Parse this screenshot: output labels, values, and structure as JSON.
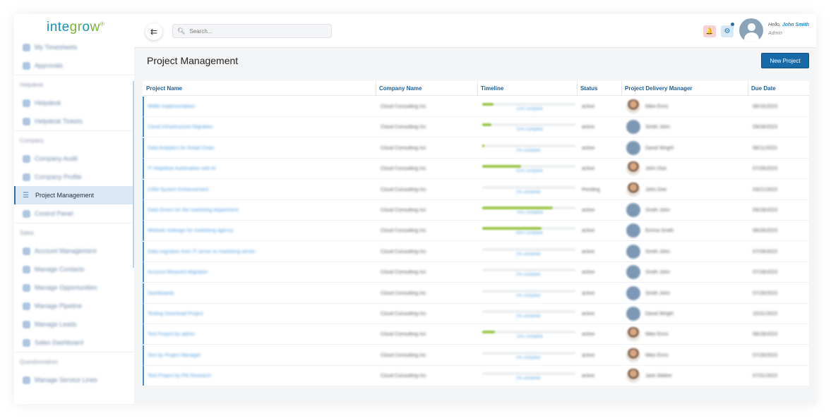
{
  "brand": {
    "logo_a": "inte",
    "logo_b": "gr",
    "logo_c": "o",
    "logo_d": "w",
    "logo_mark": "®"
  },
  "sidebar": {
    "items": [
      {
        "label": "My Timesheets",
        "type": "item"
      },
      {
        "label": "Approvals",
        "type": "item"
      },
      {
        "label": "Helpdesk",
        "type": "section"
      },
      {
        "label": "Helpdesk",
        "type": "item"
      },
      {
        "label": "Helpdesk Tickets",
        "type": "item"
      },
      {
        "label": "Company",
        "type": "section"
      },
      {
        "label": "Company Audit",
        "type": "item"
      },
      {
        "label": "Company Profile",
        "type": "item"
      },
      {
        "label": "Project Management",
        "type": "active"
      },
      {
        "label": "Control Panel",
        "type": "item"
      },
      {
        "label": "Sales",
        "type": "section"
      },
      {
        "label": "Account Management",
        "type": "item"
      },
      {
        "label": "Manage Contacts",
        "type": "item"
      },
      {
        "label": "Manage Opportunities",
        "type": "item"
      },
      {
        "label": "Manage Pipeline",
        "type": "item"
      },
      {
        "label": "Manage Leads",
        "type": "item"
      },
      {
        "label": "Sales Dashboard",
        "type": "item"
      },
      {
        "label": "Questionnaires",
        "type": "section"
      },
      {
        "label": "Manage Service Lines",
        "type": "item"
      }
    ]
  },
  "topbar": {
    "toggle_icon": "⇇",
    "search_placeholder": "Search...",
    "bell_icon": "🔔",
    "gear_icon": "⚙",
    "hello": "Hello,",
    "user_name": "John Smith",
    "user_role": "Admin"
  },
  "page": {
    "title": "Project Management",
    "new_button": "New Project"
  },
  "table": {
    "headers": [
      "Project Name",
      "Company Name",
      "Timeline",
      "Status",
      "Project Delivery Manager",
      "Due Date"
    ],
    "rows": [
      {
        "project": "MMM Implementation",
        "company": "Cloud Consulting Inc",
        "progress": 0.12,
        "timeline_label": "12% complete",
        "status": "active",
        "avatar": "photo",
        "pdm": "Mike Enns",
        "due": "08/15/2023"
      },
      {
        "project": "Cloud Infrastructure Migration",
        "company": "Cloud Consulting Inc",
        "progress": 0.1,
        "timeline_label": "10% complete",
        "status": "active",
        "avatar": "initials",
        "pdm": "Smith John",
        "due": "09/28/2023"
      },
      {
        "project": "Data Analytics for Retail Chain",
        "company": "Cloud Consulting Inc",
        "progress": 0.02,
        "timeline_label": "2% complete",
        "status": "active",
        "avatar": "initials",
        "pdm": "David Wright",
        "due": "08/11/2023"
      },
      {
        "project": "IT Helpdesk Automation with AI",
        "company": "Cloud Consulting Inc",
        "progress": 0.42,
        "timeline_label": "42% complete",
        "status": "active",
        "avatar": "photo",
        "pdm": "John Doe",
        "due": "07/28/2023"
      },
      {
        "project": "CRM System Enhancement",
        "company": "Cloud Consulting Inc",
        "progress": 0.0,
        "timeline_label": "0% complete",
        "status": "Pending",
        "avatar": "photo",
        "pdm": "John Doe",
        "due": "03/21/2023"
      },
      {
        "project": "Data Driven for the marketing department",
        "company": "Cloud Consulting Inc",
        "progress": 0.76,
        "timeline_label": "76% complete",
        "status": "active",
        "avatar": "initials",
        "pdm": "Smith John",
        "due": "09/28/2023"
      },
      {
        "project": "Website redesign for marketing agency",
        "company": "Cloud Consulting Inc",
        "progress": 0.64,
        "timeline_label": "64% complete",
        "status": "active",
        "avatar": "initials",
        "pdm": "Emma Smith",
        "due": "08/28/2023"
      },
      {
        "project": "Data migration from IT server to marketing server",
        "company": "Cloud Consulting Inc",
        "progress": 0.0,
        "timeline_label": "0% complete",
        "status": "active",
        "avatar": "initials",
        "pdm": "Smith John",
        "due": "07/28/2023"
      },
      {
        "project": "Account Weasont Migration",
        "company": "Cloud Consulting Inc",
        "progress": 0.0,
        "timeline_label": "0% complete",
        "status": "active",
        "avatar": "initials",
        "pdm": "Smith John",
        "due": "07/28/2023"
      },
      {
        "project": "Dashboards",
        "company": "Cloud Consulting Inc",
        "progress": 0.0,
        "timeline_label": "0% complete",
        "status": "active",
        "avatar": "initials",
        "pdm": "Smith John",
        "due": "07/28/2023"
      },
      {
        "project": "Testing Download Project",
        "company": "Cloud Consulting Inc",
        "progress": 0.0,
        "timeline_label": "0% complete",
        "status": "active",
        "avatar": "initials",
        "pdm": "David Wright",
        "due": "10/31/2023"
      },
      {
        "project": "Test Project by admin",
        "company": "Cloud Consulting Inc",
        "progress": 0.14,
        "timeline_label": "14% complete",
        "status": "active",
        "avatar": "photo",
        "pdm": "Mike Enns",
        "due": "08/28/2023"
      },
      {
        "project": "Test by Project Manager",
        "company": "Cloud Consulting Inc",
        "progress": 0.0,
        "timeline_label": "0% complete",
        "status": "active",
        "avatar": "photo",
        "pdm": "Mike Enns",
        "due": "07/28/2023"
      },
      {
        "project": "Test Project by PM Research",
        "company": "Cloud Consulting Inc",
        "progress": 0.0,
        "timeline_label": "0% complete",
        "status": "active",
        "avatar": "photo",
        "pdm": "Jack Walker",
        "due": "07/31/2023"
      }
    ]
  },
  "colors": {
    "accent": "#1869a8",
    "progress": "#9cc74a",
    "link": "#4f9ee0",
    "header_text": "#1f5f95"
  }
}
